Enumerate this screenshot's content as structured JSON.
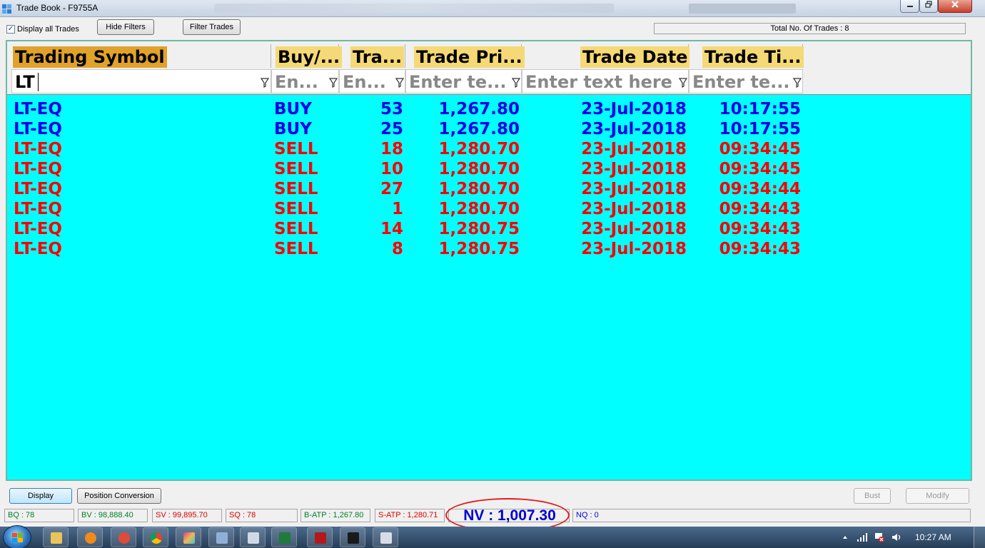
{
  "window": {
    "title": "Trade Book - F9755A"
  },
  "toolbar": {
    "display_all_label": "Display all Trades",
    "hide_filters_label": "Hide Filters",
    "filter_trades_label": "Filter Trades",
    "total_trades": "Total No. Of Trades : 8"
  },
  "grid": {
    "columns": [
      {
        "label": "Trading Symbol",
        "filter_value": "LT"
      },
      {
        "label": "Buy/...",
        "filter_placeholder": "En..."
      },
      {
        "label": "Tra...",
        "filter_placeholder": "En..."
      },
      {
        "label": "Trade Pri...",
        "filter_placeholder": "Enter te..."
      },
      {
        "label": "Trade Date",
        "filter_placeholder": "Enter text here"
      },
      {
        "label": "Trade Ti...",
        "filter_placeholder": "Enter te..."
      }
    ],
    "rows": [
      {
        "symbol": "LT-EQ",
        "side": "BUY",
        "qty": "53",
        "price": "1,267.80",
        "date": "23-Jul-2018",
        "time": "10:17:55"
      },
      {
        "symbol": "LT-EQ",
        "side": "BUY",
        "qty": "25",
        "price": "1,267.80",
        "date": "23-Jul-2018",
        "time": "10:17:55"
      },
      {
        "symbol": "LT-EQ",
        "side": "SELL",
        "qty": "18",
        "price": "1,280.70",
        "date": "23-Jul-2018",
        "time": "09:34:45"
      },
      {
        "symbol": "LT-EQ",
        "side": "SELL",
        "qty": "10",
        "price": "1,280.70",
        "date": "23-Jul-2018",
        "time": "09:34:45"
      },
      {
        "symbol": "LT-EQ",
        "side": "SELL",
        "qty": "27",
        "price": "1,280.70",
        "date": "23-Jul-2018",
        "time": "09:34:44"
      },
      {
        "symbol": "LT-EQ",
        "side": "SELL",
        "qty": "1",
        "price": "1,280.70",
        "date": "23-Jul-2018",
        "time": "09:34:43"
      },
      {
        "symbol": "LT-EQ",
        "side": "SELL",
        "qty": "14",
        "price": "1,280.75",
        "date": "23-Jul-2018",
        "time": "09:34:43"
      },
      {
        "symbol": "LT-EQ",
        "side": "SELL",
        "qty": "8",
        "price": "1,280.75",
        "date": "23-Jul-2018",
        "time": "09:34:43"
      }
    ]
  },
  "bottom": {
    "display_label": "Display",
    "position_conversion_label": "Position Conversion",
    "bust_label": "Bust",
    "modify_label": "Modify",
    "stats": {
      "bq": "BQ : 78",
      "bv": "BV : 98,888.40",
      "sv": "SV : 99,895.70",
      "sq": "SQ : 78",
      "batp": "B-ATP : 1,267.80",
      "satp": "S-ATP : 1,280.71",
      "nv": "NV : 1,007.30",
      "nq": "NQ : 0"
    }
  },
  "taskbar": {
    "clock": "10:27 AM"
  },
  "colors": {
    "grid_bg": "#00ffff",
    "buy": "#0000e6",
    "sell": "#ff0000",
    "header_highlight": "#f4d976",
    "header_highlight_active": "#e0a22a"
  }
}
